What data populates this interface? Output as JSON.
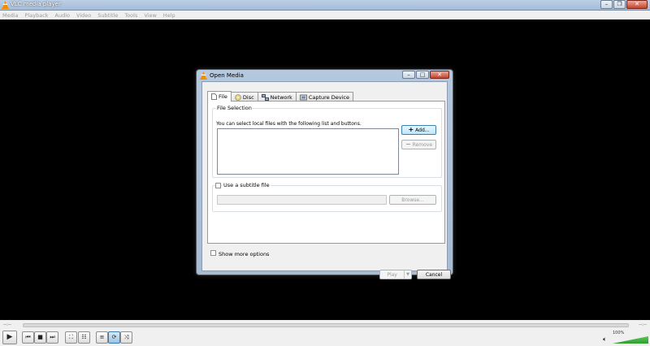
{
  "window": {
    "title": "VLC media player",
    "minimize_icon": "minimize-icon",
    "maximize_icon": "maximize-icon",
    "close_icon": "close-icon"
  },
  "menubar": {
    "items": [
      "Media",
      "Playback",
      "Audio",
      "Video",
      "Subtitle",
      "Tools",
      "View",
      "Help"
    ]
  },
  "seek": {
    "elapsed": "--:--",
    "remaining": "--:--"
  },
  "controls": {
    "buttons": [
      "play-icon",
      "previous-icon",
      "stop-icon",
      "next-icon",
      "fullscreen-icon",
      "playlist-icon",
      "loop-icon",
      "shuffle-icon"
    ],
    "volume_label": "100%",
    "volume_level": 1.0
  },
  "dialog": {
    "title": "Open Media",
    "tabs": [
      {
        "label": "File",
        "icon": "file-icon",
        "selected": true
      },
      {
        "label": "Disc",
        "icon": "disc-icon",
        "selected": false
      },
      {
        "label": "Network",
        "icon": "network-icon",
        "selected": false
      },
      {
        "label": "Capture Device",
        "icon": "capture-device-icon",
        "selected": false
      }
    ],
    "file_selection": {
      "heading": "File Selection",
      "hint": "You can select local files with the following list and buttons.",
      "add_label": "Add...",
      "remove_label": "Remove"
    },
    "subtitle": {
      "checkbox_label": "Use a subtitle file",
      "browse_label": "Browse..."
    },
    "show_more_label": "Show more options",
    "play_label": "Play",
    "cancel_label": "Cancel"
  },
  "colors": {
    "titlebar": "#a4bcd6",
    "dialog_frame": "#b5c8dd",
    "focus_button": "#3c7fb1",
    "volume_fill": "#2f9e2f"
  }
}
